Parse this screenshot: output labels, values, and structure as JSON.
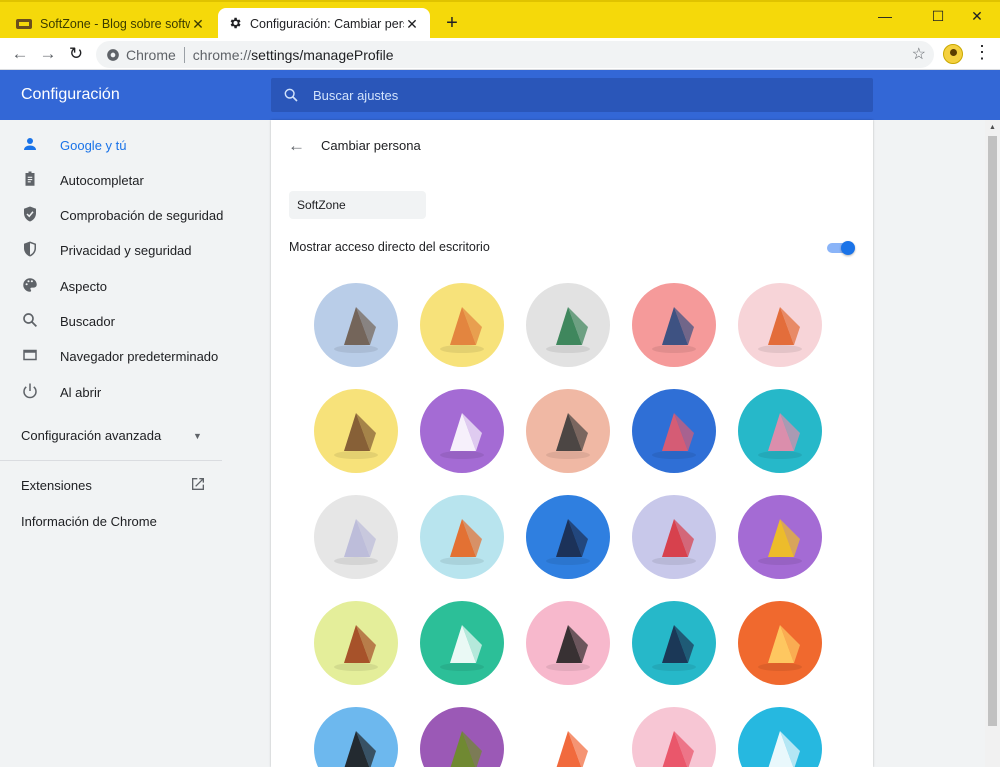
{
  "tabs": [
    {
      "title": "SoftZone - Blog sobre software, Windows, Linux",
      "close": "✕",
      "favicon": "softzone-icon"
    },
    {
      "title": "Configuración: Cambiar persona",
      "close": "✕",
      "favicon": "gear-icon"
    }
  ],
  "new_tab": "+",
  "window_controls": {
    "minimize": "—",
    "maximize": "☐",
    "close": "✕"
  },
  "omnibox": {
    "chip": "Chrome",
    "scheme_host": "chrome://",
    "path": "settings/manageProfile"
  },
  "settings": {
    "title": "Configuración",
    "search_placeholder": "Buscar ajustes"
  },
  "sidebar": {
    "items": [
      {
        "label": "Google y tú",
        "icon": "person-icon",
        "active": true
      },
      {
        "label": "Autocompletar",
        "icon": "clipboard-icon",
        "active": false
      },
      {
        "label": "Comprobación de seguridad",
        "icon": "shield-check-icon",
        "active": false
      },
      {
        "label": "Privacidad y seguridad",
        "icon": "shield-icon",
        "active": false
      },
      {
        "label": "Aspecto",
        "icon": "palette-icon",
        "active": false
      },
      {
        "label": "Buscador",
        "icon": "search-icon",
        "active": false
      },
      {
        "label": "Navegador predeterminado",
        "icon": "browser-icon",
        "active": false
      },
      {
        "label": "Al abrir",
        "icon": "power-icon",
        "active": false
      }
    ],
    "advanced": "Configuración avanzada",
    "extensions": "Extensiones",
    "about": "Información de Chrome"
  },
  "main": {
    "title": "Cambiar persona",
    "name_value": "SoftZone",
    "shortcut_label": "Mostrar acceso directo del escritorio",
    "shortcut_enabled": true
  },
  "colors": {
    "accent": "#1a73e8",
    "header": "#3367d6",
    "titlebar": "#f5d90a"
  },
  "avatars": [
    {
      "name": "cat",
      "bg": "#b9cde8"
    },
    {
      "name": "corgi",
      "bg": "#f7e27a"
    },
    {
      "name": "dragon",
      "bg": "#e2e2e2"
    },
    {
      "name": "elephant",
      "bg": "#f59a9a"
    },
    {
      "name": "fox",
      "bg": "#f7d4d8"
    },
    {
      "name": "monkey",
      "bg": "#f7e27a"
    },
    {
      "name": "panda",
      "bg": "#a46bd4"
    },
    {
      "name": "penguin",
      "bg": "#f0b8a4"
    },
    {
      "name": "butterfly",
      "bg": "#2f6fd6"
    },
    {
      "name": "rabbit",
      "bg": "#26b8c9"
    },
    {
      "name": "unicorn",
      "bg": "#e6e6e6"
    },
    {
      "name": "basketball",
      "bg": "#b8e4ee"
    },
    {
      "name": "bike",
      "bg": "#2f7fe0"
    },
    {
      "name": "bird",
      "bg": "#c8c8ea"
    },
    {
      "name": "cheese",
      "bg": "#a46bd4"
    },
    {
      "name": "football",
      "bg": "#e4ee9a"
    },
    {
      "name": "sushi-plate",
      "bg": "#2cbf98"
    },
    {
      "name": "glasses",
      "bg": "#f7b8cc"
    },
    {
      "name": "sushi",
      "bg": "#26b8c9"
    },
    {
      "name": "tamagotchi",
      "bg": "#f0692e"
    },
    {
      "name": "vinyl",
      "bg": "#6db8ee"
    },
    {
      "name": "avocado",
      "bg": "#9b59b6"
    },
    {
      "name": "watermelon",
      "bg": "#ffffff"
    },
    {
      "name": "ice-cream",
      "bg": "#f7c6d4"
    },
    {
      "name": "origami-cube",
      "bg": "#26b8e0"
    }
  ]
}
